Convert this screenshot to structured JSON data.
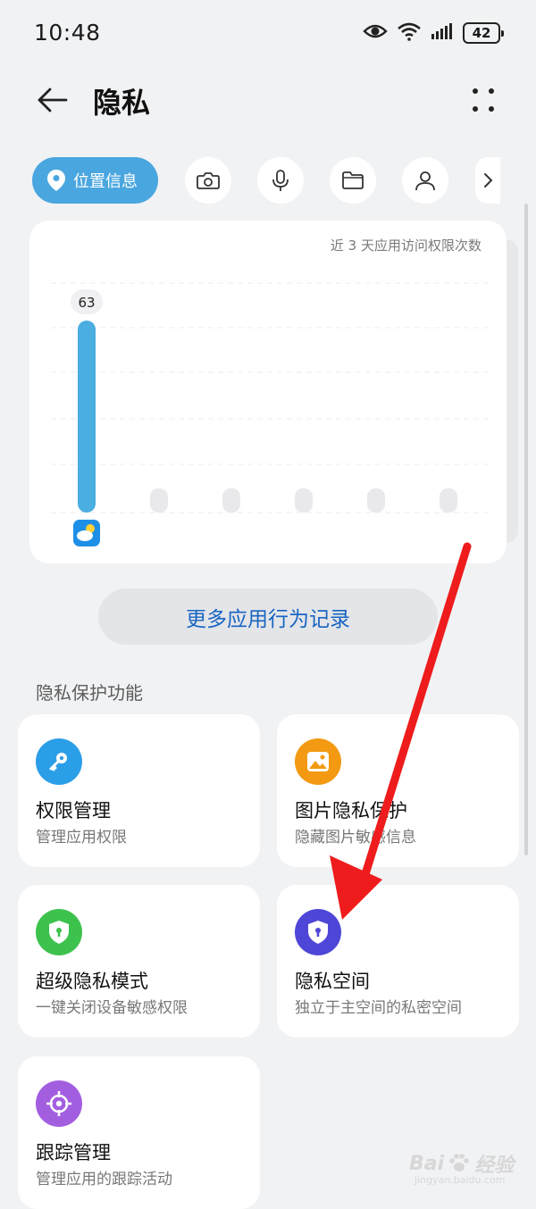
{
  "status_bar": {
    "time": "10:48",
    "battery": "42",
    "icons": [
      "eye-icon",
      "wifi-icon",
      "signal-icon",
      "battery-icon"
    ]
  },
  "header": {
    "title": "隐私",
    "back_icon": "arrow-left-icon",
    "more_icon": "more-dots-icon"
  },
  "chips": {
    "active": {
      "label": "位置信息",
      "icon": "location-pin-icon"
    },
    "others": [
      "camera-icon",
      "microphone-icon",
      "folder-icon",
      "contacts-icon"
    ],
    "next_icon": "chevron-right-icon"
  },
  "chart_data": {
    "type": "bar",
    "title": "近 3 天应用访问权限次数",
    "categories": [
      "weather-app",
      "",
      "",
      "",
      "",
      ""
    ],
    "values": [
      63,
      0,
      0,
      0,
      0,
      0
    ],
    "ylim": [
      0,
      70
    ],
    "grid": true,
    "bar_color": "#4aaee0",
    "empty_bar_color": "#e9e9eb",
    "data_labels": [
      "63"
    ]
  },
  "more_records": {
    "label": "更多应用行为记录"
  },
  "section": {
    "title": "隐私保护功能"
  },
  "features": [
    {
      "title": "权限管理",
      "desc": "管理应用权限",
      "icon": "key-icon",
      "color": "#2b9ee8"
    },
    {
      "title": "图片隐私保护",
      "desc": "隐藏图片敏感信息",
      "icon": "image-icon",
      "color": "#f39a12"
    },
    {
      "title": "超级隐私模式",
      "desc": "一键关闭设备敏感权限",
      "icon": "shield-lock-icon",
      "color": "#3cc24d"
    },
    {
      "title": "隐私空间",
      "desc": "独立于主空间的私密空间",
      "icon": "shield-lock-icon",
      "color": "#4e46d6"
    },
    {
      "title": "跟踪管理",
      "desc": "管理应用的跟踪活动",
      "icon": "target-icon",
      "color": "#a35ee0"
    }
  ],
  "annotation": {
    "arrow_color": "#ee1c1c"
  },
  "watermark": {
    "text": "Bai",
    "suffix": "经验",
    "sub": "jingyan.baidu.com"
  }
}
